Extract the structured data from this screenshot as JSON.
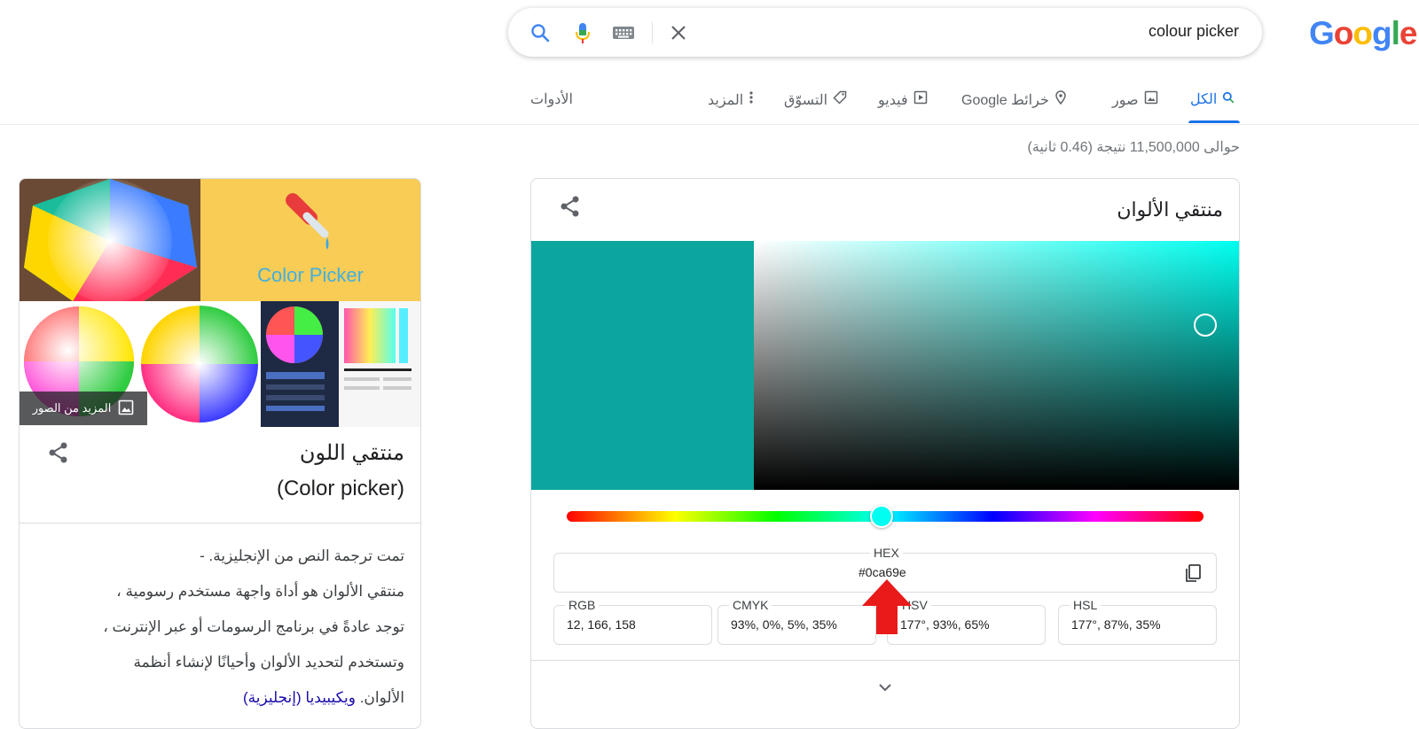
{
  "logo": {
    "letters": [
      "G",
      "o",
      "o",
      "g",
      "l",
      "e"
    ],
    "colors": [
      "#4285f4",
      "#ea4335",
      "#fbbc05",
      "#4285f4",
      "#34a853",
      "#ea4335"
    ]
  },
  "search": {
    "query": "colour picker"
  },
  "tabs": [
    {
      "label": "الكل",
      "icon": "search-icon",
      "active": true
    },
    {
      "label": "صور",
      "icon": "image-icon"
    },
    {
      "label": "خرائط Google",
      "icon": "map-pin-icon"
    },
    {
      "label": "فيديو",
      "icon": "video-icon"
    },
    {
      "label": "التسوّق",
      "icon": "tag-icon"
    },
    {
      "label": "المزيد",
      "icon": "more-vert-icon"
    },
    {
      "label": "الأدوات"
    }
  ],
  "result_stats": "حوالى 11,500,000 نتيجة (0.46 ثانية)",
  "color_picker": {
    "title": "منتقي الألوان",
    "selected_color": "#0ca69e",
    "hue_color": "#00fff0",
    "hue_degrees": 177,
    "hex": {
      "label": "HEX",
      "value": "#0ca69e"
    },
    "rgb": {
      "label": "RGB",
      "value": "12, 166, 158"
    },
    "cmyk": {
      "label": "CMYK",
      "value": "93%, 0%, 5%, 35%"
    },
    "hsv": {
      "label": "HSV",
      "value": "177°, 93%, 65%"
    },
    "hsl": {
      "label": "HSL",
      "value": "177°, 87%, 35%"
    }
  },
  "annotation": {
    "arrow_color": "#e81a1a"
  },
  "knowledge_panel": {
    "more_images": "المزيد من الصور",
    "logo_text": "Color Picker",
    "title_line1": "منتقي اللون",
    "title_line2": "(Color picker)",
    "desc_line1": "تمت ترجمة النص من الإنجليزية. -",
    "desc_line2": "منتقي الألوان هو أداة واجهة مستخدم رسومية ،",
    "desc_line3": "توجد عادةً في برنامج الرسومات أو عبر الإنترنت ،",
    "desc_line4": "وتستخدم لتحديد الألوان وأحيانًا لإنشاء أنظمة",
    "desc_line5": "الألوان.",
    "wiki_link": "ويكيبيديا (إنجليزية)"
  }
}
